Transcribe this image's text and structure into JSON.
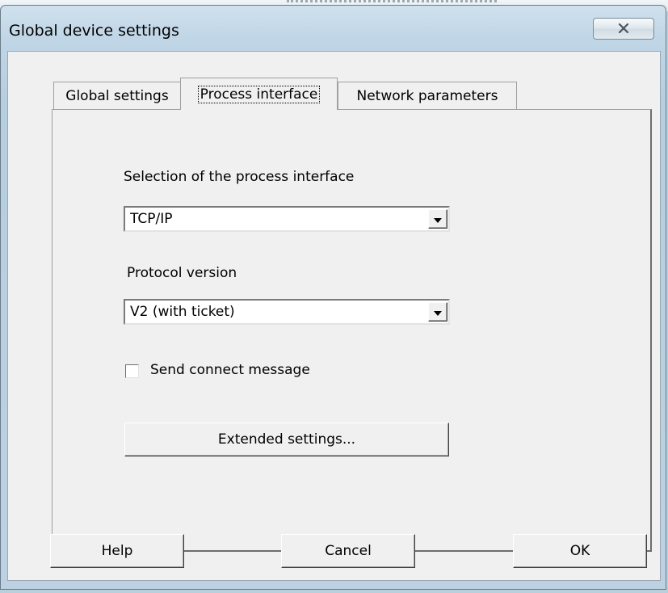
{
  "dialog": {
    "title": "Global device settings",
    "close_icon": "close-x-icon"
  },
  "tabs": [
    {
      "label": "Global settings",
      "active": false
    },
    {
      "label": "Process interface",
      "active": true
    },
    {
      "label": "Network parameters",
      "active": false
    }
  ],
  "process_interface": {
    "selection_label": "Selection of the process interface",
    "selection_value": "TCP/IP",
    "protocol_label": "Protocol version",
    "protocol_value": "V2 (with ticket)",
    "send_connect_label": "Send connect message",
    "send_connect_checked": false,
    "extended_button": "Extended settings..."
  },
  "footer": {
    "help": "Help",
    "cancel": "Cancel",
    "ok": "OK"
  },
  "colors": {
    "window_frame": "#b9cfdc",
    "client_bg": "#f0f0f0"
  }
}
